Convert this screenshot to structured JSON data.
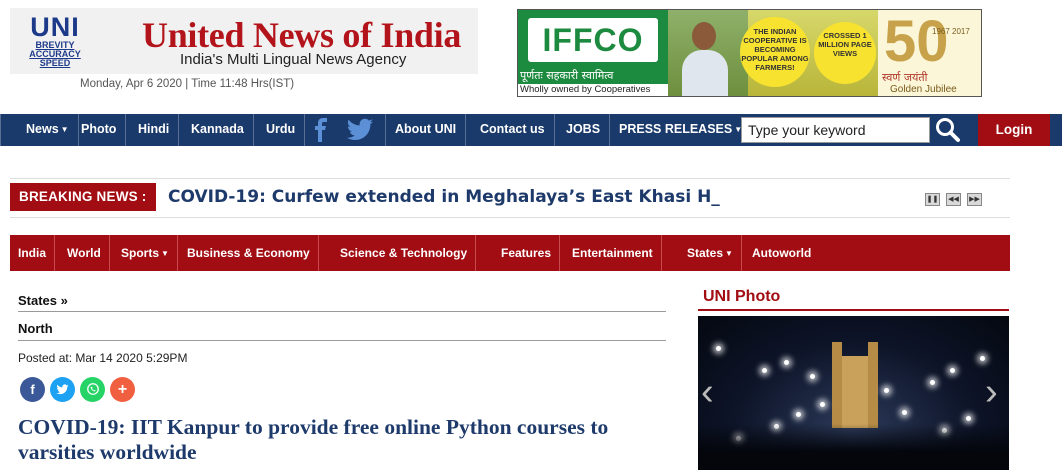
{
  "header": {
    "logo": {
      "big": "UNI",
      "line1": "BREVITY",
      "line2": "ACCURACY",
      "line3": "SPEED"
    },
    "title": "United News of India",
    "tagline": "India's Multi Lingual News Agency",
    "dateline": "Monday, Apr 6 2020 | Time 11:48 Hrs(IST)"
  },
  "ad": {
    "brand": "IFFCO",
    "hindi_line": "पूर्णतः सहकारी स्वामित्व",
    "wholly": "Wholly owned by Cooperatives",
    "circle1": "THE INDIAN COOPERATIVE IS BECOMING POPULAR AMONG FARMERS!",
    "circle2": "CROSSED 1 MILLION PAGE VIEWS",
    "fifty": "50",
    "years": "1967 2017",
    "swarn": "स्वर्ण जयंती",
    "golden": "Golden Jubilee"
  },
  "nav": {
    "items": [
      "News",
      "Photo",
      "Hindi",
      "Kannada",
      "Urdu",
      "About UNI",
      "Contact us",
      "JOBS",
      "PRESS RELEASES"
    ],
    "search_placeholder": "Type your keyword",
    "login": "Login"
  },
  "breaking": {
    "label": "BREAKING NEWS :",
    "text": "COVID-19: Curfew extended in Meghalaya’s East Khasi H_"
  },
  "categories": [
    "India",
    "World",
    "Sports",
    "Business & Economy",
    "Science & Technology",
    "Features",
    "Entertainment",
    "States",
    "Autoworld"
  ],
  "article": {
    "crumb1": "States »",
    "crumb2": "North",
    "posted": "Posted at: Mar 14 2020 5:29PM",
    "headline": "COVID-19: IIT Kanpur to provide free online Python courses to varsities worldwide"
  },
  "sidebar": {
    "title": "UNI Photo"
  },
  "colors": {
    "nav_blue": "#1a3a6b",
    "brand_red": "#a10d12",
    "headline_blue": "#1d3a6b",
    "facebook": "#3b5998",
    "twitter": "#1da1f2",
    "whatsapp": "#25d366",
    "share_more": "#f05f40"
  }
}
